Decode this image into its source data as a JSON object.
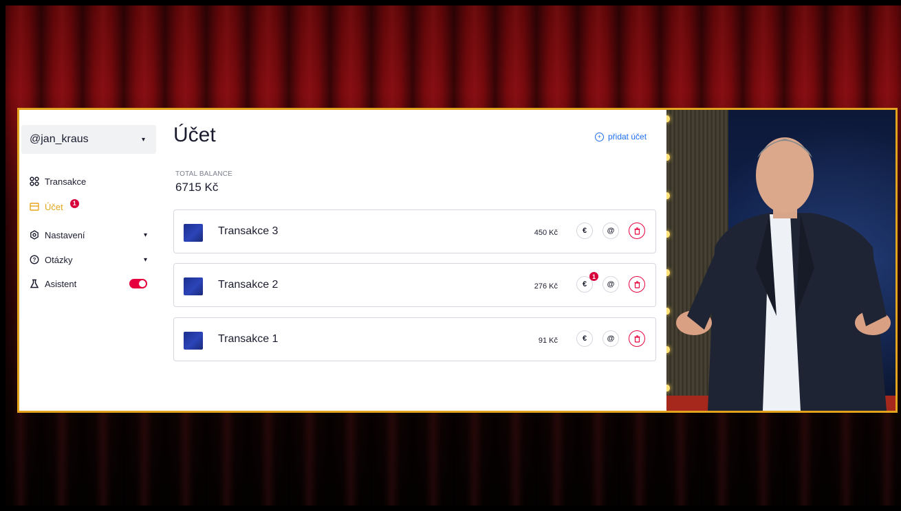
{
  "sidebar": {
    "username": "@jan_kraus",
    "items": [
      {
        "label": "Transakce"
      },
      {
        "label": "Účet",
        "badge": "1"
      },
      {
        "label": "Nastavení"
      },
      {
        "label": "Otázky"
      },
      {
        "label": "Asistent"
      }
    ]
  },
  "main": {
    "title": "Účet",
    "add_account": "přidat účet",
    "balance_label": "TOTAL BALANCE",
    "balance_value": "6715 Kč",
    "transactions": [
      {
        "name": "Transakce 3",
        "amount": "450 Kč"
      },
      {
        "name": "Transakce 2",
        "amount": "276 Kč",
        "badge": "1"
      },
      {
        "name": "Transakce 1",
        "amount": "91 Kč"
      }
    ],
    "icons": {
      "euro": "€",
      "at": "@"
    }
  },
  "colors": {
    "accent": "#e6a51a",
    "link": "#1b6ef0",
    "danger": "#e5003d",
    "frame": "#e2a41d"
  }
}
